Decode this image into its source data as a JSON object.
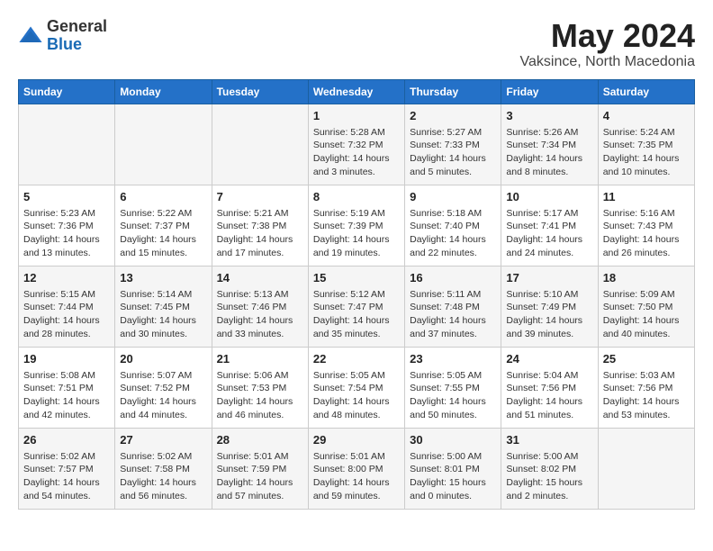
{
  "header": {
    "logo_line1": "General",
    "logo_line2": "Blue",
    "month_title": "May 2024",
    "location": "Vaksince, North Macedonia"
  },
  "weekdays": [
    "Sunday",
    "Monday",
    "Tuesday",
    "Wednesday",
    "Thursday",
    "Friday",
    "Saturday"
  ],
  "weeks": [
    [
      {
        "day": "",
        "info": ""
      },
      {
        "day": "",
        "info": ""
      },
      {
        "day": "",
        "info": ""
      },
      {
        "day": "1",
        "info": "Sunrise: 5:28 AM\nSunset: 7:32 PM\nDaylight: 14 hours\nand 3 minutes."
      },
      {
        "day": "2",
        "info": "Sunrise: 5:27 AM\nSunset: 7:33 PM\nDaylight: 14 hours\nand 5 minutes."
      },
      {
        "day": "3",
        "info": "Sunrise: 5:26 AM\nSunset: 7:34 PM\nDaylight: 14 hours\nand 8 minutes."
      },
      {
        "day": "4",
        "info": "Sunrise: 5:24 AM\nSunset: 7:35 PM\nDaylight: 14 hours\nand 10 minutes."
      }
    ],
    [
      {
        "day": "5",
        "info": "Sunrise: 5:23 AM\nSunset: 7:36 PM\nDaylight: 14 hours\nand 13 minutes."
      },
      {
        "day": "6",
        "info": "Sunrise: 5:22 AM\nSunset: 7:37 PM\nDaylight: 14 hours\nand 15 minutes."
      },
      {
        "day": "7",
        "info": "Sunrise: 5:21 AM\nSunset: 7:38 PM\nDaylight: 14 hours\nand 17 minutes."
      },
      {
        "day": "8",
        "info": "Sunrise: 5:19 AM\nSunset: 7:39 PM\nDaylight: 14 hours\nand 19 minutes."
      },
      {
        "day": "9",
        "info": "Sunrise: 5:18 AM\nSunset: 7:40 PM\nDaylight: 14 hours\nand 22 minutes."
      },
      {
        "day": "10",
        "info": "Sunrise: 5:17 AM\nSunset: 7:41 PM\nDaylight: 14 hours\nand 24 minutes."
      },
      {
        "day": "11",
        "info": "Sunrise: 5:16 AM\nSunset: 7:43 PM\nDaylight: 14 hours\nand 26 minutes."
      }
    ],
    [
      {
        "day": "12",
        "info": "Sunrise: 5:15 AM\nSunset: 7:44 PM\nDaylight: 14 hours\nand 28 minutes."
      },
      {
        "day": "13",
        "info": "Sunrise: 5:14 AM\nSunset: 7:45 PM\nDaylight: 14 hours\nand 30 minutes."
      },
      {
        "day": "14",
        "info": "Sunrise: 5:13 AM\nSunset: 7:46 PM\nDaylight: 14 hours\nand 33 minutes."
      },
      {
        "day": "15",
        "info": "Sunrise: 5:12 AM\nSunset: 7:47 PM\nDaylight: 14 hours\nand 35 minutes."
      },
      {
        "day": "16",
        "info": "Sunrise: 5:11 AM\nSunset: 7:48 PM\nDaylight: 14 hours\nand 37 minutes."
      },
      {
        "day": "17",
        "info": "Sunrise: 5:10 AM\nSunset: 7:49 PM\nDaylight: 14 hours\nand 39 minutes."
      },
      {
        "day": "18",
        "info": "Sunrise: 5:09 AM\nSunset: 7:50 PM\nDaylight: 14 hours\nand 40 minutes."
      }
    ],
    [
      {
        "day": "19",
        "info": "Sunrise: 5:08 AM\nSunset: 7:51 PM\nDaylight: 14 hours\nand 42 minutes."
      },
      {
        "day": "20",
        "info": "Sunrise: 5:07 AM\nSunset: 7:52 PM\nDaylight: 14 hours\nand 44 minutes."
      },
      {
        "day": "21",
        "info": "Sunrise: 5:06 AM\nSunset: 7:53 PM\nDaylight: 14 hours\nand 46 minutes."
      },
      {
        "day": "22",
        "info": "Sunrise: 5:05 AM\nSunset: 7:54 PM\nDaylight: 14 hours\nand 48 minutes."
      },
      {
        "day": "23",
        "info": "Sunrise: 5:05 AM\nSunset: 7:55 PM\nDaylight: 14 hours\nand 50 minutes."
      },
      {
        "day": "24",
        "info": "Sunrise: 5:04 AM\nSunset: 7:56 PM\nDaylight: 14 hours\nand 51 minutes."
      },
      {
        "day": "25",
        "info": "Sunrise: 5:03 AM\nSunset: 7:56 PM\nDaylight: 14 hours\nand 53 minutes."
      }
    ],
    [
      {
        "day": "26",
        "info": "Sunrise: 5:02 AM\nSunset: 7:57 PM\nDaylight: 14 hours\nand 54 minutes."
      },
      {
        "day": "27",
        "info": "Sunrise: 5:02 AM\nSunset: 7:58 PM\nDaylight: 14 hours\nand 56 minutes."
      },
      {
        "day": "28",
        "info": "Sunrise: 5:01 AM\nSunset: 7:59 PM\nDaylight: 14 hours\nand 57 minutes."
      },
      {
        "day": "29",
        "info": "Sunrise: 5:01 AM\nSunset: 8:00 PM\nDaylight: 14 hours\nand 59 minutes."
      },
      {
        "day": "30",
        "info": "Sunrise: 5:00 AM\nSunset: 8:01 PM\nDaylight: 15 hours\nand 0 minutes."
      },
      {
        "day": "31",
        "info": "Sunrise: 5:00 AM\nSunset: 8:02 PM\nDaylight: 15 hours\nand 2 minutes."
      },
      {
        "day": "",
        "info": ""
      }
    ]
  ]
}
